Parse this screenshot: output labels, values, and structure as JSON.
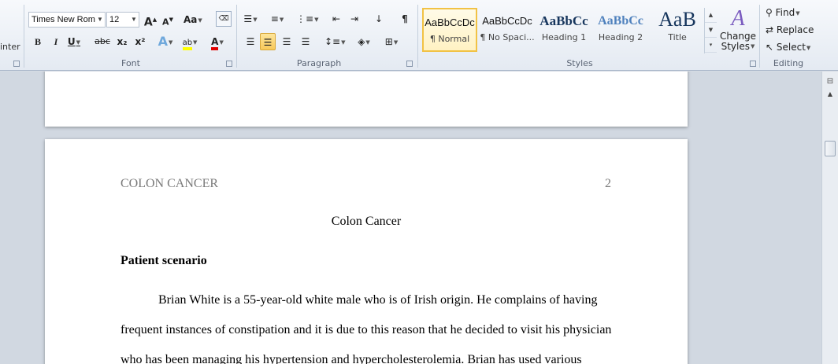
{
  "ribbon": {
    "clipboard_partial_label": "inter",
    "font": {
      "group_label": "Font",
      "font_name": "Times New Rom",
      "font_size": "12",
      "grow_label": "A",
      "shrink_label": "A",
      "change_case_label": "Aa",
      "bold": "B",
      "italic": "I",
      "underline": "U",
      "strikethrough": "abc",
      "subscript": "x₂",
      "superscript": "x²",
      "text_effects": "A",
      "highlight": "ab",
      "font_color": "A"
    },
    "paragraph": {
      "group_label": "Paragraph"
    },
    "styles": {
      "group_label": "Styles",
      "items": [
        {
          "sample": "AaBbCcDc",
          "name": "¶ Normal"
        },
        {
          "sample": "AaBbCcDc",
          "name": "¶ No Spaci..."
        },
        {
          "sample": "AaBbCc",
          "name": "Heading 1"
        },
        {
          "sample": "AaBbCc",
          "name": "Heading 2"
        },
        {
          "sample": "AaB",
          "name": "Title"
        }
      ],
      "change_styles_line1": "Change",
      "change_styles_line2": "Styles"
    },
    "editing": {
      "group_label": "Editing",
      "find": "Find",
      "replace": "Replace",
      "select": "Select"
    }
  },
  "document": {
    "header_left": "COLON CANCER",
    "page_number": "2",
    "title": "Colon Cancer",
    "heading": "Patient scenario",
    "lines": [
      "Brian White is a 55-year-old white male who is of Irish origin. He complains of having",
      "frequent instances of constipation and it is due to this reason that he decided to visit his physician",
      "who has been managing his hypertension and hypercholesterolemia.   Brian has used various"
    ]
  },
  "colors": {
    "ribbon_bg": "#e4eaf2",
    "selected_tile": "#f1c245",
    "heading_blue": "#17365d",
    "heading2_blue": "#4f81bd"
  }
}
